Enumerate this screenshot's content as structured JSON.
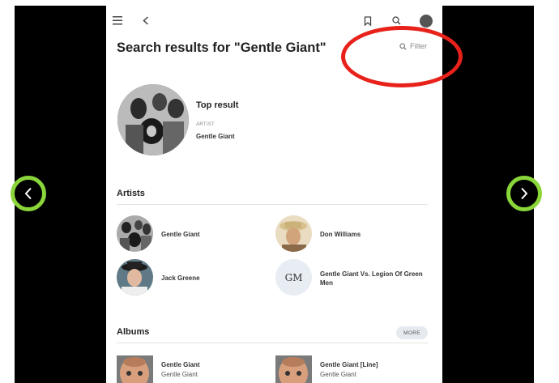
{
  "page": {
    "title": "Search results for \"Gentle Giant\"",
    "filter_label": "Filter"
  },
  "top_result": {
    "heading": "Top result",
    "type": "ARTIST",
    "name": "Gentle Giant"
  },
  "artists": {
    "heading": "Artists",
    "items": [
      {
        "name": "Gentle Giant"
      },
      {
        "name": "Don Williams"
      },
      {
        "name": "Jack Greene"
      },
      {
        "name": "Gentle Giant Vs. Legion Of Green Men",
        "initials": "GM"
      }
    ]
  },
  "albums": {
    "heading": "Albums",
    "more_label": "MORE",
    "items": [
      {
        "title": "Gentle Giant",
        "artist": "Gentle Giant"
      },
      {
        "title": "Gentle Giant [Line]",
        "artist": "Gentle Giant"
      }
    ]
  },
  "icons": {
    "menu": "hamburger-menu-icon",
    "back": "chevron-left-icon",
    "bookmark": "bookmark-icon",
    "search": "search-icon",
    "prev": "chevron-left-icon",
    "next": "chevron-right-icon"
  },
  "colors": {
    "annotation_red": "#e8221b",
    "annotation_green": "#8ad53a",
    "more_button_bg": "#e6eaf0"
  }
}
